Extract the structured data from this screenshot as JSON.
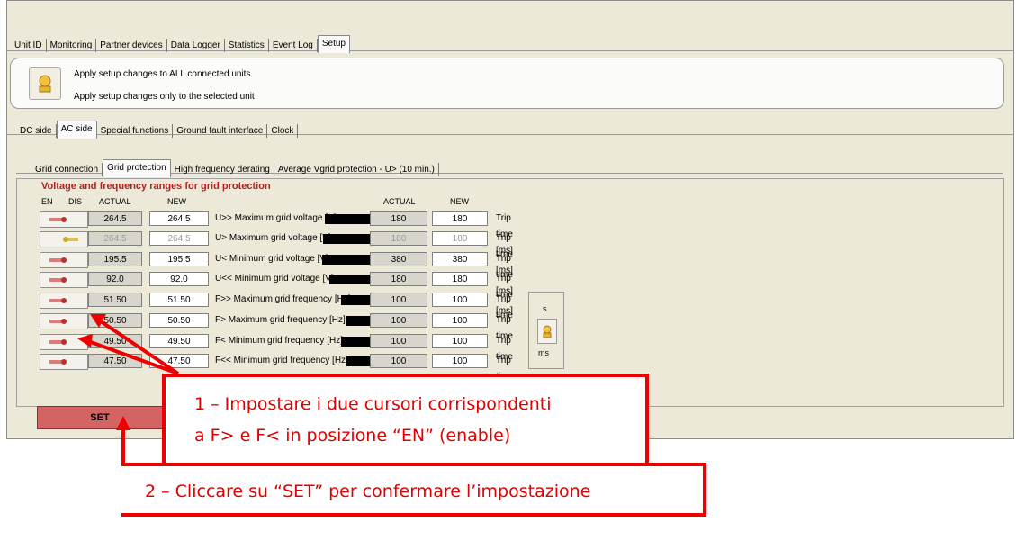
{
  "main_tabs": [
    "Unit ID",
    "Monitoring",
    "Partner devices",
    "Data Logger",
    "Statistics",
    "Event Log",
    "Setup"
  ],
  "apply": {
    "all": "Apply setup changes to ALL connected units",
    "selected": "Apply setup changes only to the selected unit"
  },
  "sub_tabs": [
    "DC side",
    "AC side",
    "Special functions",
    "Ground fault interface",
    "Clock"
  ],
  "protection_tabs": [
    "Grid connection",
    "Grid protection",
    "High frequency derating",
    "Average Vgrid protection - U> (10 min.)"
  ],
  "group_title": "Voltage and frequency ranges for grid protection",
  "headers": {
    "en": "EN",
    "dis": "DIS",
    "actual": "ACTUAL",
    "new": "NEW",
    "actual2": "ACTUAL",
    "new2": "NEW"
  },
  "rows": [
    {
      "actual": "264.5",
      "new": "264.5",
      "label": "U>> Maximum grid voltage [V]",
      "actual2": "180",
      "new2": "180",
      "trip": "Trip time [ms]",
      "state": "EN"
    },
    {
      "actual": "264.5",
      "new": "264.5",
      "label": "U> Maximum grid voltage [V]",
      "actual2": "180",
      "new2": "180",
      "trip": "Trip time [ms]",
      "state": "DIS"
    },
    {
      "actual": "195.5",
      "new": "195.5",
      "label": "U< Minimum grid voltage [V]",
      "actual2": "380",
      "new2": "380",
      "trip": "Trip time [ms]",
      "state": "EN"
    },
    {
      "actual": "92.0",
      "new": "92.0",
      "label": "U<< Minimum grid voltage [V]",
      "actual2": "180",
      "new2": "180",
      "trip": "Trip time [ms]",
      "state": "EN"
    },
    {
      "actual": "51.50",
      "new": "51.50",
      "label": "F>> Maximum grid frequency [Hz]",
      "actual2": "100",
      "new2": "100",
      "trip": "Trip time",
      "state": "EN"
    },
    {
      "actual": "50.50",
      "new": "50.50",
      "label": "F> Maximum grid frequency [Hz]",
      "actual2": "100",
      "new2": "100",
      "trip": "Trip time",
      "state": "EN"
    },
    {
      "actual": "49.50",
      "new": "49.50",
      "label": "F< Minimum grid frequency [Hz]",
      "actual2": "100",
      "new2": "100",
      "trip": "Trip time",
      "state": "EN"
    },
    {
      "actual": "47.50",
      "new": "47.50",
      "label": "F<< Minimum grid frequency [Hz]",
      "actual2": "100",
      "new2": "100",
      "trip": "Trip time",
      "state": "EN"
    }
  ],
  "units": {
    "s": "s",
    "ms": "ms"
  },
  "set_label": "SET",
  "callout1": {
    "line1": "1 – Impostare i due cursori corrispondenti",
    "line2": "a F> e F< in posizione “EN” (enable)"
  },
  "callout2": "2 – Cliccare su “SET” per confermare l’impostazione",
  "colors": {
    "callout_red": "#ee0000",
    "set_button": "#d46363",
    "group_title": "#b22222"
  }
}
